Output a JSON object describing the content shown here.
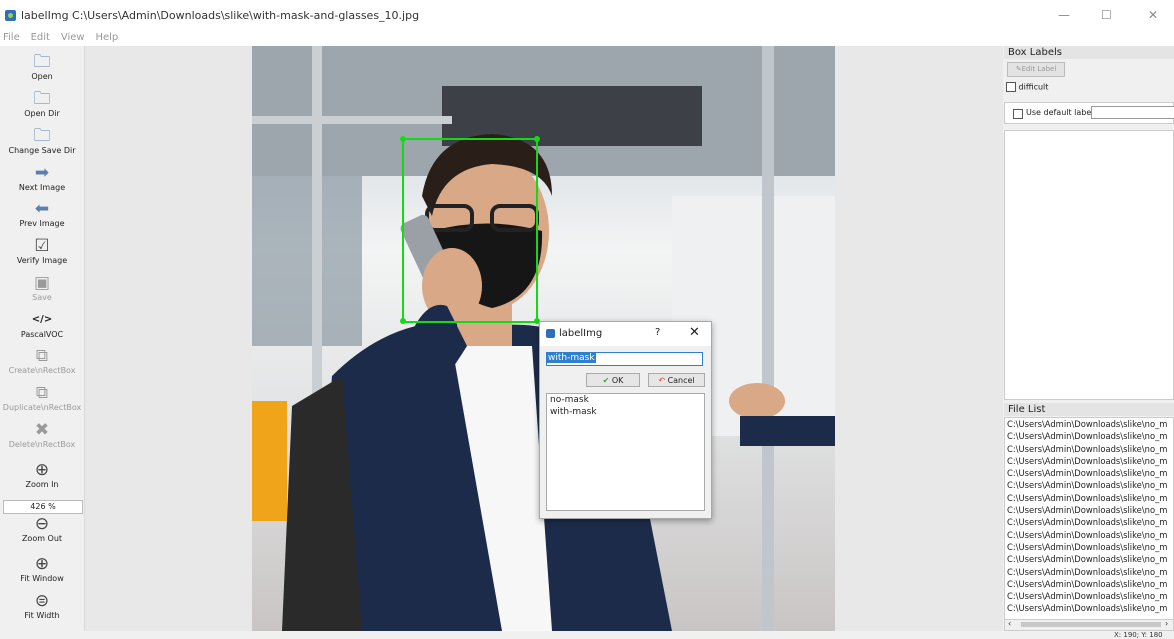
{
  "window": {
    "title": "labelImg C:\\Users\\Admin\\Downloads\\slike\\with-mask-and-glasses_10.jpg",
    "minimize": "—",
    "maximize": "☐",
    "close": "✕"
  },
  "menu": [
    "File",
    "Edit",
    "View",
    "Help"
  ],
  "toolbar": {
    "open": "Open",
    "open_dir": "Open Dir",
    "change_save_dir": "Change Save Dir",
    "next_image": "Next Image",
    "prev_image": "Prev Image",
    "verify_image": "Verify Image",
    "save": "Save",
    "format_icon": "</>",
    "format": "PascalVOC",
    "create_rect": "Create\\nRectBox",
    "duplicate_rect": "Duplicate\\nRectBox",
    "delete_rect": "Delete\\nRectBox",
    "zoom_in": "Zoom In",
    "zoom_value": "426 %",
    "zoom_out": "Zoom Out",
    "fit_window": "Fit Window",
    "fit_width": "Fit Width"
  },
  "dialog": {
    "title": "labelImg",
    "help": "?",
    "close": "✕",
    "input_value": "with-mask",
    "ok": "OK",
    "cancel": "Cancel",
    "options": [
      "no-mask",
      "with-mask"
    ]
  },
  "right_panel": {
    "box_labels_title": "Box Labels",
    "edit_label": "Edit Label",
    "difficult": "difficult",
    "use_default_label": "Use default label",
    "file_list_title": "File List",
    "files": [
      "C:\\Users\\Admin\\Downloads\\slike\\no_m",
      "C:\\Users\\Admin\\Downloads\\slike\\no_m",
      "C:\\Users\\Admin\\Downloads\\slike\\no_m",
      "C:\\Users\\Admin\\Downloads\\slike\\no_m",
      "C:\\Users\\Admin\\Downloads\\slike\\no_m",
      "C:\\Users\\Admin\\Downloads\\slike\\no_m",
      "C:\\Users\\Admin\\Downloads\\slike\\no_m",
      "C:\\Users\\Admin\\Downloads\\slike\\no_m",
      "C:\\Users\\Admin\\Downloads\\slike\\no_m",
      "C:\\Users\\Admin\\Downloads\\slike\\no_m",
      "C:\\Users\\Admin\\Downloads\\slike\\no_m",
      "C:\\Users\\Admin\\Downloads\\slike\\no_m",
      "C:\\Users\\Admin\\Downloads\\slike\\no_m",
      "C:\\Users\\Admin\\Downloads\\slike\\no_m",
      "C:\\Users\\Admin\\Downloads\\slike\\no_m",
      "C:\\Users\\Admin\\Downloads\\slike\\no_m"
    ]
  },
  "status": {
    "coords": "X: 190; Y: 180"
  },
  "colors": {
    "bbox": "#16d916",
    "accent": "#2d7fd3"
  }
}
